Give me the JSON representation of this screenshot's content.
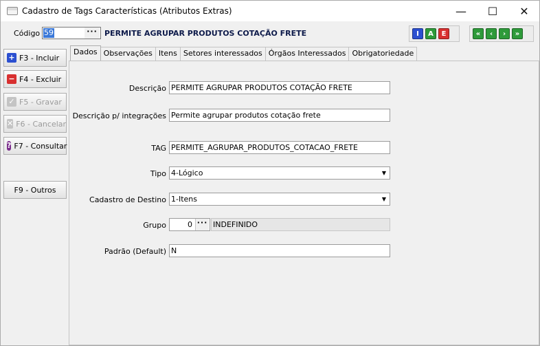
{
  "window": {
    "title": "Cadastro de Tags Características (Atributos Extras)",
    "controls": {
      "minimize": "—",
      "maximize": "☐",
      "close": "✕"
    }
  },
  "header": {
    "codigo_label": "Código",
    "codigo_value": "59",
    "dots": "···",
    "description": "PERMITE AGRUPAR PRODUTOS COTAÇÃO FRETE",
    "action_buttons": [
      {
        "letter": "I",
        "color": "#2b4fd0"
      },
      {
        "letter": "A",
        "color": "#2e9a3a"
      },
      {
        "letter": "E",
        "color": "#d83030"
      }
    ],
    "nav_buttons": [
      {
        "glyph": "«",
        "color": "#2e9a3a"
      },
      {
        "glyph": "‹",
        "color": "#2e9a3a"
      },
      {
        "glyph": "›",
        "color": "#2e9a3a"
      },
      {
        "glyph": "»",
        "color": "#2e9a3a"
      }
    ]
  },
  "sidebar": {
    "buttons": [
      {
        "label": "F3 - Incluir",
        "icon": "+",
        "icon_color": "#2b4fd0",
        "enabled": true
      },
      {
        "label": "F4 - Excluir",
        "icon": "−",
        "icon_color": "#d83030",
        "enabled": true
      },
      {
        "label": "F5 - Gravar",
        "icon": "✓",
        "icon_color": "#b8b8b8",
        "enabled": false
      },
      {
        "label": "F6 - Cancelar",
        "icon": "✕",
        "icon_color": "#b8b8b8",
        "enabled": false
      },
      {
        "label": "F7 - Consultar",
        "icon": "?",
        "icon_color": "#7a2d8c",
        "enabled": true
      },
      {
        "label": "F9 - Outros",
        "icon": "",
        "icon_color": "",
        "enabled": true
      }
    ]
  },
  "tabs": [
    "Dados",
    "Observações",
    "Itens",
    "Setores interessados",
    "Órgãos Interessados",
    "Obrigatoriedade"
  ],
  "form": {
    "descricao": {
      "label": "Descrição",
      "value": "PERMITE AGRUPAR PRODUTOS COTAÇÃO FRETE"
    },
    "descricao_integracoes": {
      "label": "Descrição p/ integrações",
      "value": "Permite agrupar produtos cotação frete"
    },
    "tag": {
      "label": "TAG",
      "value": "PERMITE_AGRUPAR_PRODUTOS_COTACAO_FRETE"
    },
    "tipo": {
      "label": "Tipo",
      "value": "4-Lógico"
    },
    "cadastro_destino": {
      "label": "Cadastro de Destino",
      "value": "1-Itens"
    },
    "grupo": {
      "label": "Grupo",
      "code": "0",
      "name": "INDEFINIDO"
    },
    "padrao": {
      "label": "Padrão (Default)",
      "value": "N"
    }
  }
}
